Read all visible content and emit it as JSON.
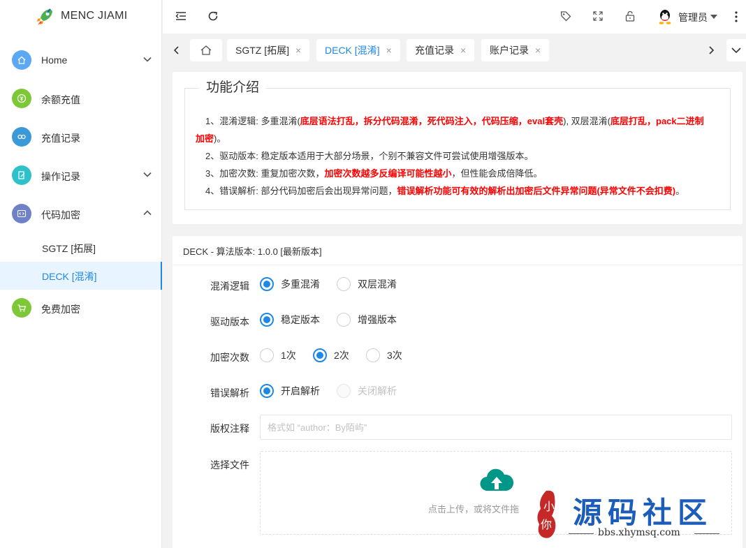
{
  "app": {
    "title": "MENC JIAMI"
  },
  "sidebar": {
    "items": [
      {
        "label": "Home",
        "icon": "home-icon",
        "color": "#5ba8f5",
        "arrow": "down"
      },
      {
        "label": "余额充值",
        "icon": "yen-icon",
        "color": "#7cc837",
        "arrow": ""
      },
      {
        "label": "充值记录",
        "icon": "link-icon",
        "color": "#3a9ad9",
        "arrow": ""
      },
      {
        "label": "操作记录",
        "icon": "edit-icon",
        "color": "#2fc1c9",
        "arrow": "down"
      },
      {
        "label": "代码加密",
        "icon": "code-icon",
        "color": "#6f82c9",
        "arrow": "up"
      }
    ],
    "subitems": [
      {
        "label": "SGTZ [拓展]"
      },
      {
        "label": "DECK [混淆]"
      }
    ],
    "last_item": {
      "label": "免费加密",
      "icon": "cart-icon",
      "color": "#7cc837"
    }
  },
  "header": {
    "user_name": "管理员"
  },
  "tabs": [
    {
      "label": "SGTZ [拓展]",
      "close": "×"
    },
    {
      "label": "DECK [混淆]",
      "close": "×"
    },
    {
      "label": "充值记录",
      "close": "×"
    },
    {
      "label": "账户记录",
      "close": "×"
    }
  ],
  "intro": {
    "legend": "功能介绍",
    "line1_a": "1、混淆逻辑: 多重混淆(",
    "line1_b": "底层语法打乱，拆分代码混淆，死代码注入，代码压缩，eval套壳",
    "line1_c": "), 双层混淆(",
    "line1_d": "底层打乱，pack二进制加密",
    "line1_e": ")。",
    "line2": "2、驱动版本: 稳定版本适用于大部分场景，个别不兼容文件可尝试使用增强版本。",
    "line3_a": "3、加密次数: 重复加密次数，",
    "line3_b": "加密次数越多反编译可能性越小",
    "line3_c": "，但性能会成倍降低。",
    "line4_a": "4、错误解析: 部分代码加密后会出现异常问题，",
    "line4_b": "错误解析功能可有效的解析出加密后文件异常问题(异常文件不会扣费)",
    "line4_c": "。"
  },
  "form": {
    "header": "DECK - 算法版本: 1.0.0 [最新版本]",
    "logic": {
      "label": "混淆逻辑",
      "options": [
        "多重混淆",
        "双层混淆"
      ],
      "selected": 0
    },
    "driver": {
      "label": "驱动版本",
      "options": [
        "稳定版本",
        "增强版本"
      ],
      "selected": 0
    },
    "count": {
      "label": "加密次数",
      "options": [
        "1次",
        "2次",
        "3次"
      ],
      "selected": 1
    },
    "errparse": {
      "label": "错误解析",
      "options": [
        "开启解析",
        "关闭解析"
      ],
      "selected": 0,
      "disabled": 1
    },
    "copyright": {
      "label": "版权注释",
      "placeholder": "格式如 “author：By陌屿”"
    },
    "file": {
      "label": "选择文件",
      "hint": "点击上传，或将文件拖"
    }
  },
  "watermark": {
    "big": "源码社区",
    "url": "bbs.xhymsq.com",
    "badge": "小 你"
  },
  "colors": {
    "accent": "#1e88e5",
    "upload": "#009688",
    "warn": "#ff0000"
  }
}
